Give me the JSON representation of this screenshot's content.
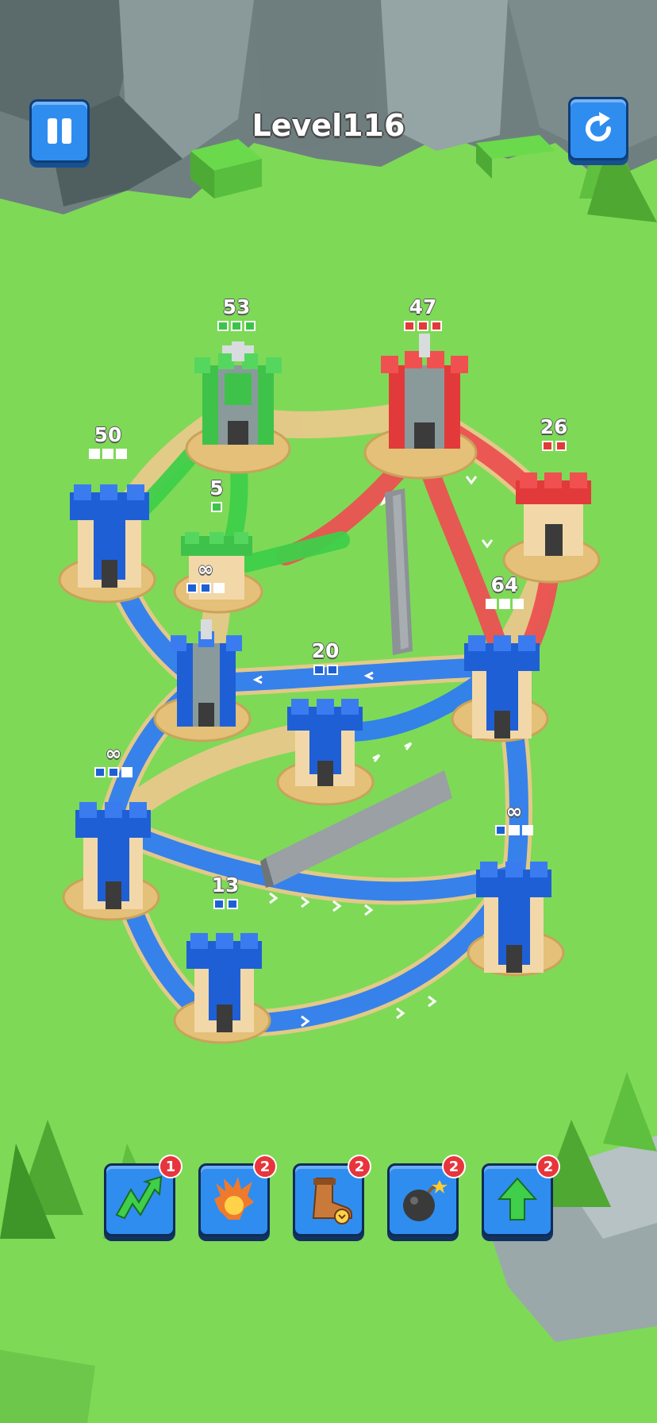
{
  "header": {
    "level_title": "Level116",
    "pause_icon": "pause-icon",
    "restart_icon": "restart-icon"
  },
  "towers": [
    {
      "id": "green-castle",
      "team": "green",
      "count": "53",
      "pips": [
        "green",
        "green",
        "green"
      ]
    },
    {
      "id": "red-castle",
      "team": "red",
      "count": "47",
      "pips": [
        "red",
        "red",
        "red"
      ]
    },
    {
      "id": "red-tower-small",
      "team": "red",
      "count": "26",
      "pips": [
        "red",
        "red"
      ]
    },
    {
      "id": "neutral-left-top",
      "team": "blue",
      "count": "50",
      "pips": [
        "empty",
        "empty",
        "empty"
      ]
    },
    {
      "id": "green-small",
      "team": "green",
      "count": "5",
      "pips": [
        "green"
      ]
    },
    {
      "id": "blue-infinity-1",
      "team": "blue",
      "count": "∞",
      "pips": [
        "blue",
        "blue",
        "empty"
      ]
    },
    {
      "id": "blue-right-64",
      "team": "blue",
      "count": "64",
      "pips": [
        "empty",
        "empty",
        "empty"
      ]
    },
    {
      "id": "blue-center-20",
      "team": "blue",
      "count": "20",
      "pips": [
        "blue",
        "blue"
      ]
    },
    {
      "id": "blue-left-infinity",
      "team": "blue",
      "count": "∞",
      "pips": [
        "blue",
        "blue",
        "empty"
      ]
    },
    {
      "id": "blue-right-infinity",
      "team": "blue",
      "count": "∞",
      "pips": [
        "blue",
        "empty",
        "empty"
      ]
    },
    {
      "id": "blue-bottom-13",
      "team": "blue",
      "count": "13",
      "pips": [
        "blue",
        "blue"
      ]
    }
  ],
  "powerups": [
    {
      "name": "lightning-powerup",
      "icon": "green-lightning-icon",
      "count": "1"
    },
    {
      "name": "fire-powerup",
      "icon": "fireball-icon",
      "count": "2"
    },
    {
      "name": "speed-boot-powerup",
      "icon": "boot-icon",
      "count": "2"
    },
    {
      "name": "bomb-powerup",
      "icon": "bomb-icon",
      "count": "2"
    },
    {
      "name": "upgrade-powerup",
      "icon": "up-arrow-icon",
      "count": "2"
    }
  ],
  "colors": {
    "grass": "#7ed957",
    "blue_team": "#1f5fd6",
    "red_team": "#e23a3a",
    "green_team": "#3fc24a",
    "path": "#e8c98a",
    "rock": "#7a8a8c"
  }
}
